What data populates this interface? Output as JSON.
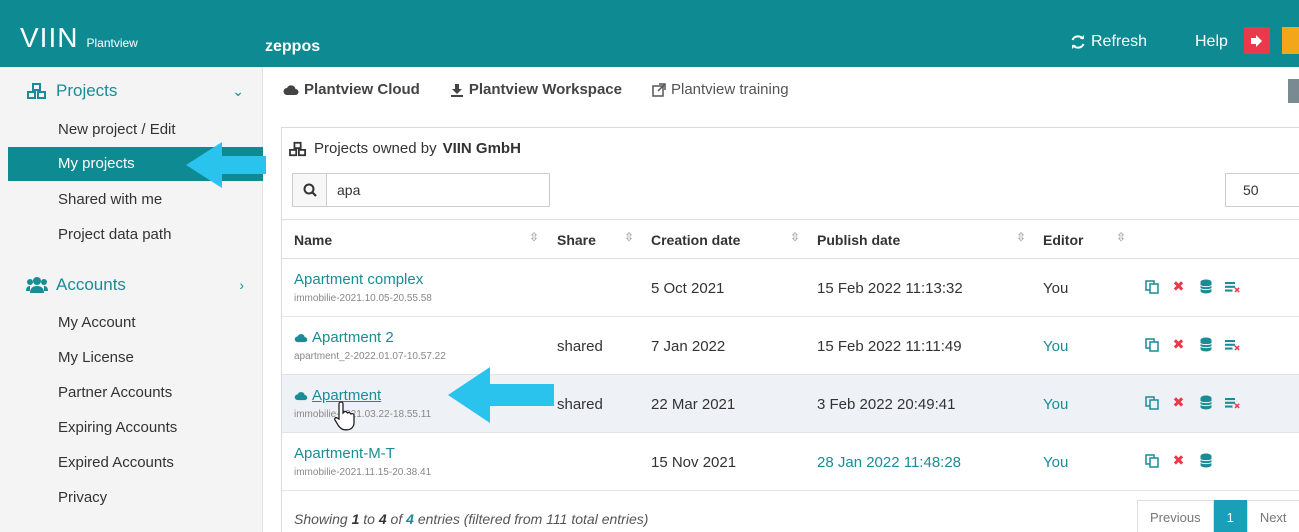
{
  "topbar": {
    "brand_logo": "VIIN",
    "brand_sub": "Plantview",
    "app_title": "zeppos",
    "refresh_label": "Refresh",
    "help_label": "Help"
  },
  "sidebar": {
    "projects_label": "Projects",
    "project_items": [
      "New project / Edit",
      "My projects",
      "Shared with me",
      "Project data path"
    ],
    "accounts_label": "Accounts",
    "account_items": [
      "My Account",
      "My License",
      "Partner Accounts",
      "Expiring Accounts",
      "Expired Accounts",
      "Privacy"
    ]
  },
  "tabs": {
    "cloud": "Plantview Cloud",
    "workspace": "Plantview Workspace",
    "training": "Plantview training"
  },
  "panel": {
    "title_prefix": "Projects owned by",
    "title_owner": "VIIN GmbH",
    "search_value": "apa",
    "page_size": "50"
  },
  "table": {
    "headers": {
      "name": "Name",
      "share": "Share",
      "created": "Creation date",
      "published": "Publish date",
      "editor": "Editor"
    },
    "rows": [
      {
        "name": "Apartment complex",
        "sub": "immobilie-2021.10.05-20.55.58",
        "share": "",
        "created": "5 Oct 2021",
        "published": "15 Feb 2022 11:13:32",
        "editor": "You",
        "cloud": false
      },
      {
        "name": "Apartment 2",
        "sub": "apartment_2-2022.01.07-10.57.22",
        "share": "shared",
        "created": "7 Jan 2022",
        "published": "15 Feb 2022 11:11:49",
        "editor": "You",
        "cloud": true
      },
      {
        "name": "Apartment",
        "sub": "immobilie-2021.03.22-18.55.11",
        "share": "shared",
        "created": "22 Mar 2021",
        "published": "3 Feb 2022 20:49:41",
        "editor": "You",
        "cloud": true
      },
      {
        "name": "Apartment-M-T",
        "sub": "immobilie-2021.11.15-20.38.41",
        "share": "",
        "created": "15 Nov 2021",
        "published": "28 Jan 2022 11:48:28",
        "editor": "You",
        "cloud": false
      }
    ]
  },
  "footer": {
    "showing": "Showing",
    "from": "1",
    "to_word": "to",
    "to": "4",
    "of_word": "of",
    "total": "4",
    "entries_text": "entries (filtered from 111 total entries)",
    "prev_label": "Previous",
    "page": "1",
    "next_label": "Next"
  },
  "colors": {
    "teal": "#0e8a93",
    "arrow": "#29c3ee",
    "danger": "#e9394b"
  }
}
